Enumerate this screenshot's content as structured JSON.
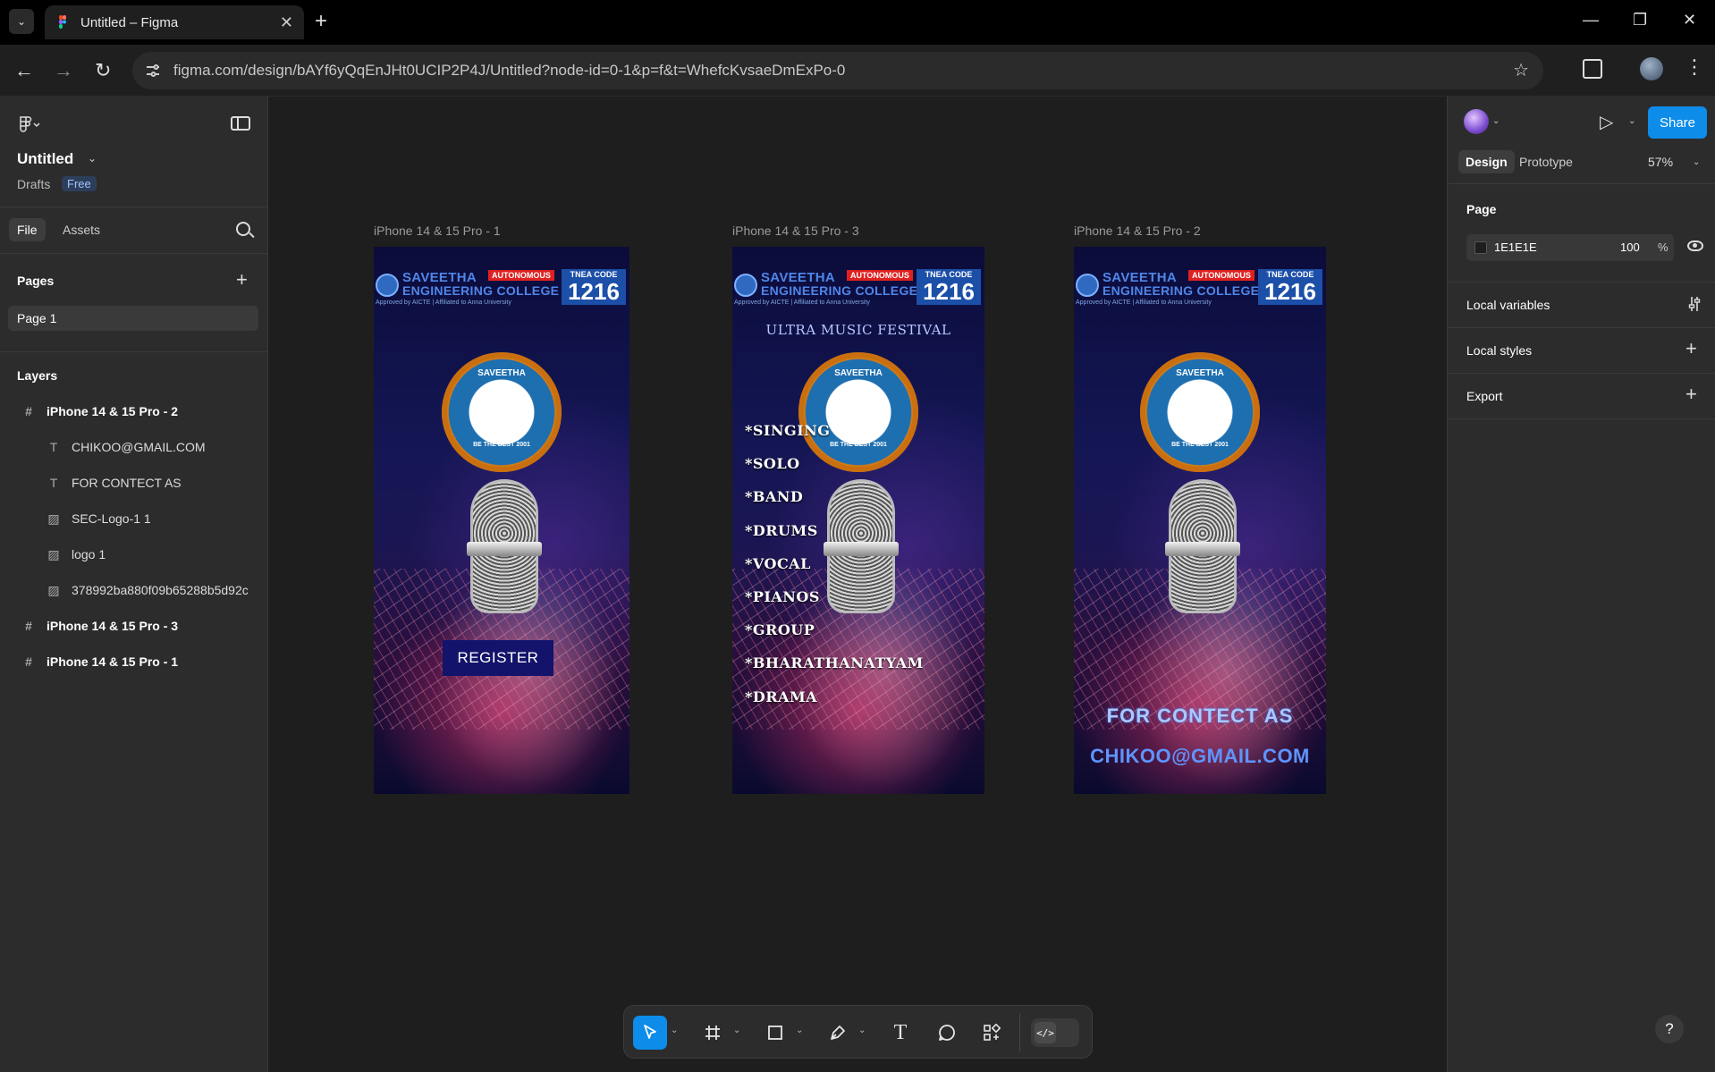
{
  "browser": {
    "tab_title": "Untitled – Figma",
    "url": "figma.com/design/bAYf6yQqEnJHt0UCIP2P4J/Untitled?node-id=0-1&p=f&t=WhefcKvsaeDmExPo-0",
    "new_tab": "+",
    "tab_close": "✕",
    "minimize": "—",
    "restore": "❐",
    "close": "✕",
    "back": "←",
    "forward": "→",
    "reload": "↻",
    "bookmark": "☆",
    "menu": "⋮",
    "tab_menu": "⌄"
  },
  "left_panel": {
    "file_name": "Untitled",
    "drafts_label": "Drafts",
    "plan_badge": "Free",
    "tabs": [
      "File",
      "Assets"
    ],
    "pages_title": "Pages",
    "pages": [
      "Page 1"
    ],
    "layers_title": "Layers",
    "layers": [
      {
        "name": "iPhone 14 & 15 Pro - 2",
        "type": "frame",
        "icon": "#"
      },
      {
        "name": "CHIKOO@GMAIL.COM",
        "type": "text",
        "icon": "T"
      },
      {
        "name": "FOR CONTECT AS",
        "type": "text",
        "icon": "T"
      },
      {
        "name": "SEC-Logo-1 1",
        "type": "image",
        "icon": "▨"
      },
      {
        "name": "logo 1",
        "type": "image",
        "icon": "▨"
      },
      {
        "name": "378992ba880f09b65288b5d92c",
        "type": "image",
        "icon": "▨"
      },
      {
        "name": "iPhone 14 & 15 Pro - 3",
        "type": "frame",
        "icon": "#"
      },
      {
        "name": "iPhone 14 & 15 Pro - 1",
        "type": "frame",
        "icon": "#"
      }
    ]
  },
  "canvas": {
    "frames": [
      {
        "label": "iPhone 14 & 15 Pro - 1"
      },
      {
        "label": "iPhone 14 & 15 Pro - 3"
      },
      {
        "label": "iPhone 14 & 15 Pro - 2"
      }
    ],
    "poster": {
      "college_line1": "SAVEETHA",
      "college_line2": "ENGINEERING COLLEGE",
      "autonomous": "AUTONOMOUS",
      "tnea_label": "TNEA CODE",
      "tnea_code": "1216",
      "approved": "Approved by AICTE | Affiliated to Anna University",
      "seal_top": "SAVEETHA",
      "seal_bottom": "BE THE BEST 2001"
    },
    "register_label": "REGISTER",
    "festival_title": "ULTRA MUSIC FESTIVAL",
    "events": [
      "*SINGING",
      "*SOLO",
      "*BAND",
      "*DRUMS",
      "*VOCAL",
      "*PIANOS",
      "*GROUP",
      "*BHARATHANATYAM",
      "*DRAMA"
    ],
    "contact_label": "FOR CONTECT AS",
    "contact_email": "CHIKOO@GMAIL.COM"
  },
  "toolbar": {
    "tools": [
      "move",
      "frame",
      "shape",
      "pen",
      "text",
      "comment",
      "actions"
    ],
    "dev_mode_label": "</>"
  },
  "right_panel": {
    "share_label": "Share",
    "tabs": [
      "Design",
      "Prototype"
    ],
    "zoom": "57%",
    "page_title": "Page",
    "page_color": "1E1E1E",
    "page_opacity": "100",
    "opacity_unit": "%",
    "local_variables": "Local variables",
    "local_styles": "Local styles",
    "export": "Export"
  },
  "help_label": "?",
  "colors": {
    "accent": "#0d8ce9",
    "canvas_bg": "#1e1e1e",
    "panel_bg": "#2c2c2c"
  }
}
